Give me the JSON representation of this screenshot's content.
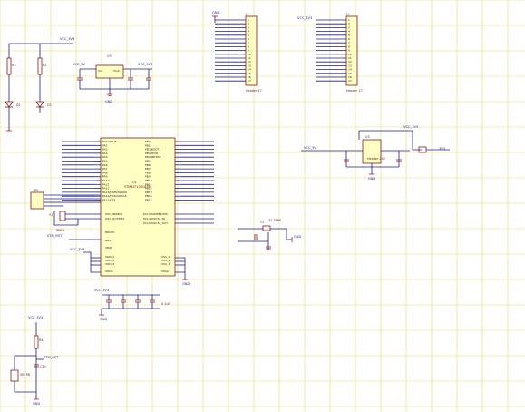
{
  "sheet": {
    "background": "#ffffff",
    "grid_color": "#e9d96a",
    "wire_color": "#1c1c8c",
    "part_color": "#8a1a1a",
    "chip_fill": "#ffffc4"
  },
  "labels": {
    "gnd": "GND",
    "vcc": "VCC_3V3",
    "vcc_5v": "VCC_5V",
    "u1_name": "U1",
    "u1_part": "STM32F103C8T6",
    "j1_name": "J1",
    "j2_name": "J2",
    "j1_type": "Header 17",
    "j2_type": "Header 17",
    "u3_name": "U3",
    "ldo_in": "Vin",
    "ldo_out": "Vout",
    "rst": "NRST",
    "boot0": "BOOT0",
    "vbat": "VBAT",
    "vdd1": "VDD_1",
    "vdd2": "VDD_2",
    "vdd3": "VDD_3",
    "vssa": "VSSA",
    "vss1": "VSS_1",
    "vss2": "VSS_2",
    "vss3": "VSS_3",
    "osc_in": "OSC_IN/PD0",
    "osc_out": "OSC_OUT/PD1",
    "rst_net": "STM_RST",
    "sw": "SW-PB",
    "cap_c10": "C10",
    "cap_val": "10uF",
    "cap_val2": "0.1uF",
    "res_r1": "R1",
    "res_r2": "R2",
    "res_r4": "R4",
    "led_d1": "D1",
    "led_d2": "D2",
    "xtal": "Y1",
    "xtal2": "Y2",
    "xtal_val": "8MHz",
    "xtal2_val": "32.768K",
    "header_p5": "P5",
    "header_p4": "Header 4X2",
    "pa_pins": [
      "PA0-WKUP",
      "PA1",
      "PA2",
      "PA3",
      "PA4",
      "PA5",
      "PA6",
      "PA7",
      "PA8",
      "PA9",
      "PA10",
      "PA11",
      "PA12",
      "PA13/JTMS/SWDIO",
      "PA14/JTCK/SWCLK",
      "PA15/JTDI"
    ],
    "pb_pins": [
      "PB0",
      "PB1",
      "PB2/BOOT1",
      "PB3/JTDO",
      "PB4/JNTRST",
      "PB5",
      "PB6",
      "PB7",
      "PB8",
      "PB9",
      "PB10",
      "PB11",
      "PB12",
      "PB13",
      "PB14",
      "PB15"
    ],
    "pc_pins": [
      "PC13-TAMPER-RTC",
      "PC14-OSC32_IN",
      "PC15-OSC32_OUT"
    ]
  }
}
